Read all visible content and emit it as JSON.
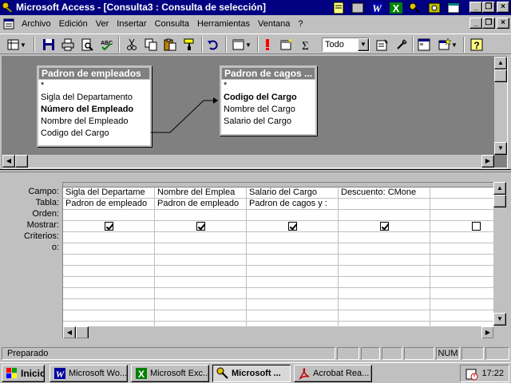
{
  "window": {
    "title": "Microsoft Access - [Consulta3 : Consulta de selección]"
  },
  "menu": {
    "items": [
      {
        "label": "Archivo"
      },
      {
        "label": "Edición"
      },
      {
        "label": "Ver"
      },
      {
        "label": "Insertar"
      },
      {
        "label": "Consulta"
      },
      {
        "label": "Herramientas"
      },
      {
        "label": "Ventana"
      },
      {
        "label": "?"
      }
    ]
  },
  "toolbar": {
    "top_values": "Todo",
    "icons": [
      "view-icon",
      "save-icon",
      "print-icon",
      "print-preview-icon",
      "spelling-icon",
      "cut-icon",
      "copy-icon",
      "paste-icon",
      "format-painter-icon",
      "undo-icon",
      "query-type-icon",
      "run-icon",
      "show-table-icon",
      "totals-icon",
      "properties-icon",
      "build-icon",
      "database-window-icon",
      "new-object-icon",
      "help-icon"
    ]
  },
  "tables": [
    {
      "name": "Padron de empleados",
      "fields": [
        {
          "name": "*",
          "key": false
        },
        {
          "name": "Sigla del Departamento",
          "key": false
        },
        {
          "name": "Número del Empleado",
          "key": true
        },
        {
          "name": "Nombre del Empleado",
          "key": false
        },
        {
          "name": "Codigo del Cargo",
          "key": false
        }
      ]
    },
    {
      "name": "Padron de cagos ...",
      "fields": [
        {
          "name": "*",
          "key": false
        },
        {
          "name": "Codigo del Cargo",
          "key": true
        },
        {
          "name": "Nombre del Cargo",
          "key": false
        },
        {
          "name": "Salario del Cargo",
          "key": false
        }
      ]
    }
  ],
  "grid": {
    "row_labels": [
      "Campo:",
      "Tabla:",
      "Orden:",
      "Mostrar:",
      "Criterios:",
      "o:"
    ],
    "columns": [
      {
        "campo": "Sigla del Departame",
        "tabla": "Padron de empleado",
        "mostrar": true
      },
      {
        "campo": "Nombre del Emplea",
        "tabla": "Padron de empleado",
        "mostrar": true
      },
      {
        "campo": "Salario del Cargo",
        "tabla": "Padron de cagos y :",
        "mostrar": true
      },
      {
        "campo": "Descuento: CMone",
        "tabla": "",
        "mostrar": true
      },
      {
        "campo": "",
        "tabla": "",
        "mostrar": false
      }
    ]
  },
  "status": {
    "text": "Preparado",
    "num": "NUM"
  },
  "taskbar": {
    "start": "Inicio",
    "tasks": [
      {
        "label": "Microsoft Wo...",
        "icon": "word-icon",
        "active": false
      },
      {
        "label": "Microsoft Exc...",
        "icon": "excel-icon",
        "active": false
      },
      {
        "label": "Microsoft ...",
        "icon": "access-icon",
        "active": true
      },
      {
        "label": "Acrobat Rea...",
        "icon": "acrobat-icon",
        "active": false
      }
    ],
    "clock": "17:22"
  }
}
